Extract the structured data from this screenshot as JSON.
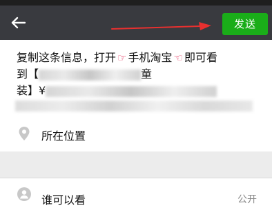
{
  "toolbar": {
    "back_icon": "back-arrow-icon",
    "send_label": "发送",
    "send_color": "#1aad19",
    "bar_color": "#393a3f"
  },
  "annotation": {
    "arrow_color": "#e8302f",
    "arrow_icon": "red-arrow-annotation"
  },
  "post": {
    "line1_text": "复制这条信息，打开",
    "line1_app": "手机淘宝",
    "line1_end": "即可看",
    "line2_start": "到【",
    "line2_end": "童",
    "line3_start": "装】¥",
    "hand_icon_left": "pointing-hand-icon",
    "hand_icon_right": "pointing-hand-icon"
  },
  "location": {
    "icon": "location-pin-icon",
    "label": "所在位置"
  },
  "visibility": {
    "icon": "people-icon",
    "label": "谁可以看",
    "value": "公开"
  }
}
